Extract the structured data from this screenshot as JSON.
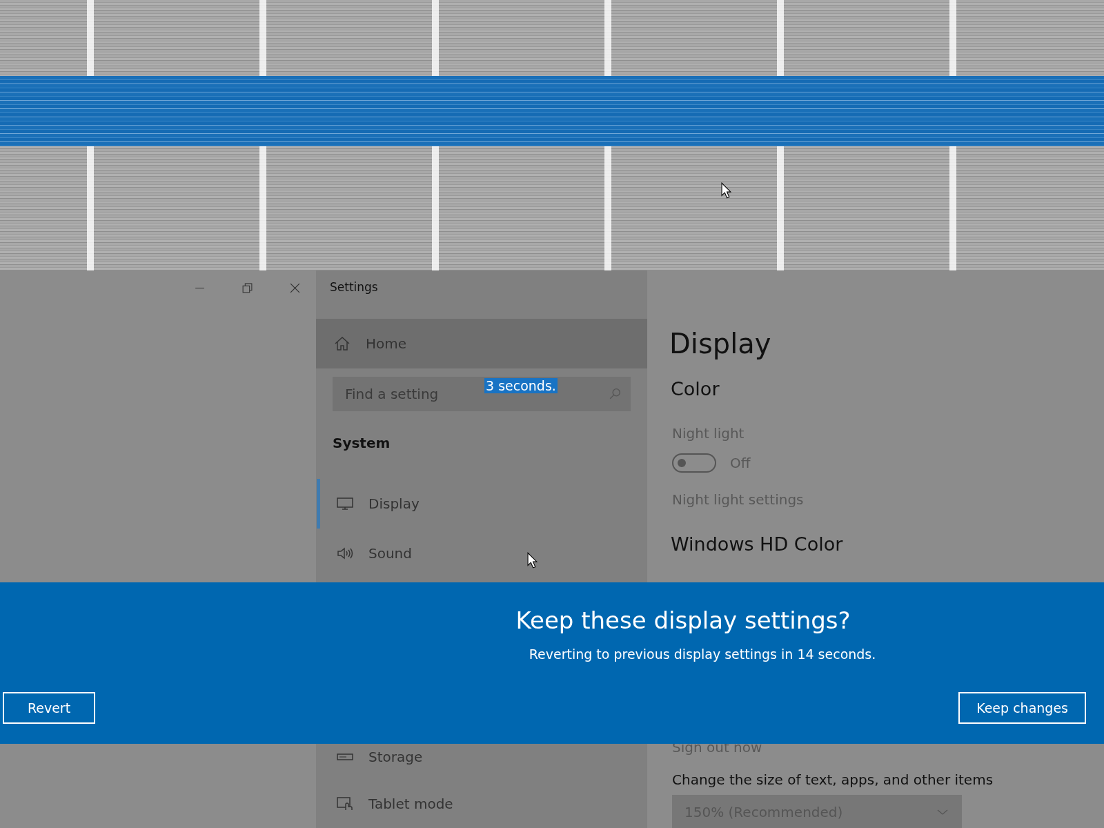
{
  "window": {
    "title": "Settings"
  },
  "sidebar": {
    "home": "Home",
    "search": {
      "placeholder": "Find a setting"
    },
    "section": "System",
    "items": [
      {
        "label": "Display",
        "selected": true
      },
      {
        "label": "Sound",
        "selected": false
      }
    ],
    "items_below_banner": [
      {
        "label": "Storage",
        "selected": false
      },
      {
        "label": "Tablet mode",
        "selected": false
      }
    ]
  },
  "selected_text": "3 seconds.",
  "content": {
    "title": "Display",
    "color_heading": "Color",
    "night_light": {
      "label": "Night light",
      "on": false,
      "state_text": "Off"
    },
    "night_light_link": "Night light settings",
    "hd_heading": "Windows HD Color",
    "sign_out": "Sign out now",
    "scale_label": "Change the size of text, apps, and other items",
    "scale_value": "150% (Recommended)"
  },
  "banner": {
    "title": "Keep these display settings?",
    "message": "Reverting to previous display settings in 14 seconds.",
    "buttons": [
      "Revert",
      "Keep changes"
    ]
  }
}
